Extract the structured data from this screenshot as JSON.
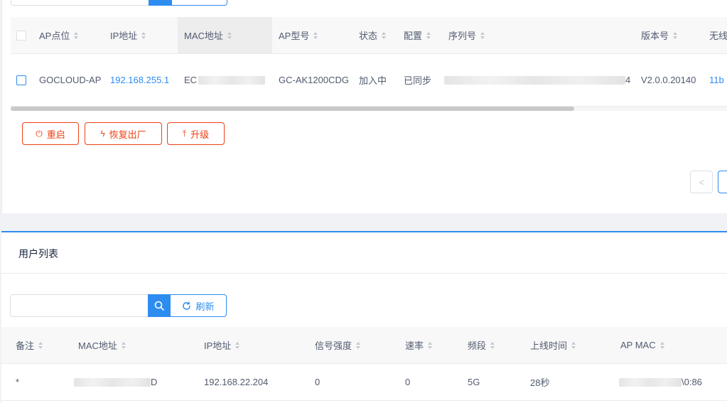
{
  "ap_table": {
    "columns": [
      {
        "label": "AP点位",
        "sortable": true
      },
      {
        "label": "IP地址",
        "sortable": true
      },
      {
        "label": "MAC地址",
        "sortable": true
      },
      {
        "label": "AP型号",
        "sortable": true
      },
      {
        "label": "状态",
        "sortable": true
      },
      {
        "label": "配置",
        "sortable": true
      },
      {
        "label": "序列号",
        "sortable": true
      },
      {
        "label": "版本号",
        "sortable": true
      },
      {
        "label": "无线",
        "sortable": false
      }
    ],
    "rows": [
      {
        "location": "GOCLOUD-AP",
        "ip": "192.168.255.1",
        "mac_prefix": "EC",
        "model": "GC-AK1200CDG",
        "status": "加入中",
        "config": "已同步",
        "serial_suffix": "4",
        "version": "V2.0.0.20140",
        "wireless": "11b"
      }
    ],
    "actions": [
      {
        "label": "重启",
        "icon": "power-icon"
      },
      {
        "label": "恢复出厂",
        "icon": "lightning-icon"
      },
      {
        "label": "升级",
        "icon": "upload-icon"
      }
    ],
    "pager": {
      "prev_icon": "chevron-left-icon",
      "prev_glyph": "<"
    }
  },
  "user_list": {
    "title": "用户列表",
    "search": {
      "value": "",
      "placeholder": ""
    },
    "refresh_label": "刷新",
    "columns": [
      {
        "label": "备注",
        "sortable": true
      },
      {
        "label": "MAC地址",
        "sortable": true
      },
      {
        "label": "IP地址",
        "sortable": true
      },
      {
        "label": "信号强度",
        "sortable": true
      },
      {
        "label": "速率",
        "sortable": true
      },
      {
        "label": "频段",
        "sortable": true
      },
      {
        "label": "上线时间",
        "sortable": true
      },
      {
        "label": "AP MAC",
        "sortable": true
      }
    ],
    "rows": [
      {
        "note": "*",
        "mac_suffix": "D",
        "ip": "192.168.22.204",
        "signal": "0",
        "rate": "0",
        "band": "5G",
        "online_time": "28秒",
        "ap_mac_suffix": "\\0:86"
      }
    ]
  },
  "colors": {
    "primary": "#2d8cf0",
    "danger": "#ed4014",
    "header_bg": "#f8f8f9",
    "text": "#515a6e"
  }
}
